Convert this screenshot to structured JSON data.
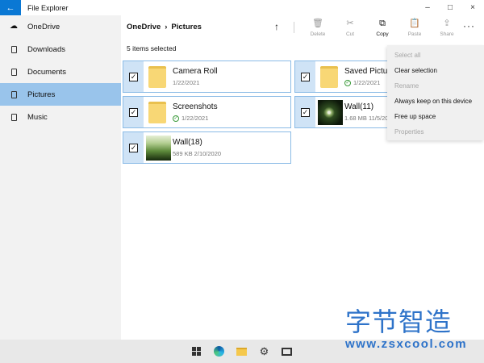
{
  "window": {
    "title": "File Explorer",
    "back_glyph": "←",
    "minimize_glyph": "–",
    "maximize_glyph": "□",
    "close_glyph": "×"
  },
  "sidebar": {
    "items": [
      {
        "label": "OneDrive",
        "icon": "cloud-icon",
        "selected": false
      },
      {
        "label": "Downloads",
        "icon": "file-icon",
        "selected": false
      },
      {
        "label": "Documents",
        "icon": "file-icon",
        "selected": false
      },
      {
        "label": "Pictures",
        "icon": "file-icon",
        "selected": true
      },
      {
        "label": "Music",
        "icon": "file-icon",
        "selected": false
      }
    ]
  },
  "breadcrumb": {
    "root": "OneDrive",
    "separator": "›",
    "current": "Pictures"
  },
  "toolbar": {
    "up_glyph": "↑",
    "more_glyph": "···",
    "items": [
      {
        "label": "Delete",
        "glyph": "🗑",
        "enabled": false
      },
      {
        "label": "Cut",
        "glyph": "✂",
        "enabled": false
      },
      {
        "label": "Copy",
        "glyph": "⧉",
        "enabled": true
      },
      {
        "label": "Paste",
        "glyph": "📋",
        "enabled": false
      },
      {
        "label": "Share",
        "glyph": "⇪",
        "enabled": false
      }
    ]
  },
  "selection_status": "5 items selected",
  "files": [
    {
      "name": "Camera Roll",
      "detail": "1/22/2021",
      "kind": "folder",
      "synced": false
    },
    {
      "name": "Saved Pictures",
      "detail": "1/22/2021",
      "kind": "folder",
      "synced": true
    },
    {
      "name": "Screenshots",
      "detail": "1/22/2021",
      "kind": "folder",
      "synced": true
    },
    {
      "name": "Wall(11)",
      "detail": "1.68 MB  11/5/2020",
      "kind": "image",
      "synced": false
    },
    {
      "name": "Wall(18)",
      "detail": "589 KB  2/10/2020",
      "kind": "image",
      "synced": false
    }
  ],
  "check_glyph": "✓",
  "sync_glyph": "✓",
  "context_menu": {
    "items": [
      {
        "label": "Select all",
        "enabled": false
      },
      {
        "label": "Clear selection",
        "enabled": true
      },
      {
        "label": "Rename",
        "enabled": false
      },
      {
        "label": "Always keep on this device",
        "enabled": true
      },
      {
        "label": "Free up space",
        "enabled": true
      },
      {
        "label": "Properties",
        "enabled": false
      }
    ]
  },
  "taskbar": {
    "gear_glyph": "⚙",
    "icons": [
      "windows-start-icon",
      "edge-icon",
      "file-explorer-icon",
      "settings-icon",
      "task-view-icon"
    ]
  },
  "watermark": {
    "chinese": "字节智造",
    "url": "www.zsxcool.com"
  },
  "colors": {
    "accent": "#0a78d4",
    "sidebar_selected": "#99c4eb",
    "tile_selected_bg": "#cfe3f6",
    "watermark": "#2e73c9"
  }
}
